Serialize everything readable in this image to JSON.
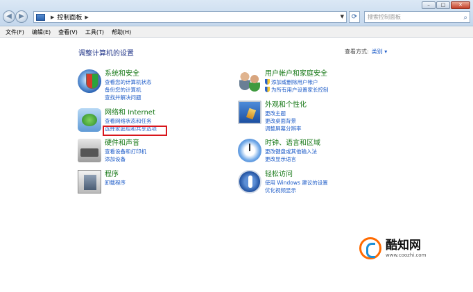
{
  "window": {
    "breadcrumb": "控制面板",
    "search_placeholder": "搜索控制面板"
  },
  "menu": [
    "文件(F)",
    "编辑(E)",
    "查看(V)",
    "工具(T)",
    "帮助(H)"
  ],
  "page": {
    "title": "调整计算机的设置",
    "view_by_label": "查看方式:",
    "view_by_value": "类别"
  },
  "categories": {
    "system": {
      "title": "系统和安全",
      "links": [
        "查看您的计算机状态",
        "备份您的计算机",
        "查找并解决问题"
      ]
    },
    "network": {
      "title": "网络和 Internet",
      "links": [
        "查看网络状态和任务",
        "选择家庭组和共享选项"
      ]
    },
    "hardware": {
      "title": "硬件和声音",
      "links": [
        "查看设备和打印机",
        "添加设备"
      ]
    },
    "programs": {
      "title": "程序",
      "links": [
        "卸载程序"
      ]
    },
    "users": {
      "title": "用户帐户和家庭安全",
      "links": [
        "添加或删除用户帐户",
        "为所有用户设置家长控制"
      ]
    },
    "appearance": {
      "title": "外观和个性化",
      "links": [
        "更改主题",
        "更改桌面背景",
        "调整屏幕分辨率"
      ]
    },
    "clock": {
      "title": "时钟、语言和区域",
      "links": [
        "更改键盘或其他输入法",
        "更改显示语言"
      ]
    },
    "access": {
      "title": "轻松访问",
      "links": [
        "使用 Windows 建议的设置",
        "优化视频显示"
      ]
    }
  },
  "watermark": {
    "title": "酷知网",
    "url": "www.coozhi.com"
  }
}
